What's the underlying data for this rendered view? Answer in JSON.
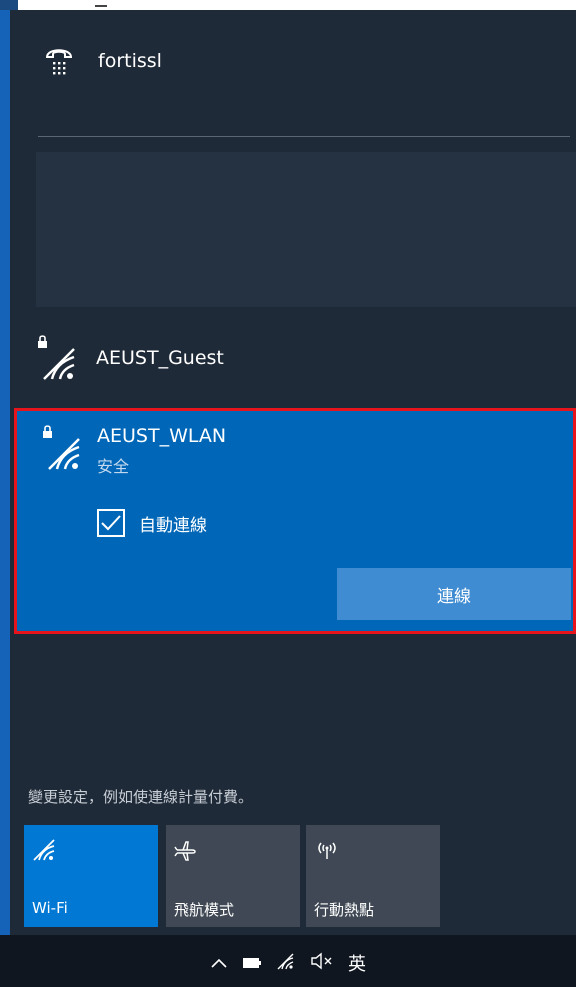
{
  "vpn": {
    "label": "fortissl",
    "icon": "vpn-dialup-icon"
  },
  "networks": [
    {
      "name": "AEUST_Guest",
      "icon": "wifi-secured-icon"
    },
    {
      "name": "AEUST_WLAN",
      "status": "安全",
      "icon": "wifi-secured-icon",
      "auto_connect_label": "自動連線",
      "auto_connect_checked": true,
      "connect_label": "連線"
    }
  ],
  "settings_link": "變更設定，例如使連線計量付費。",
  "quick_actions": [
    {
      "label": "Wi-Fi",
      "icon": "wifi-icon",
      "active": true
    },
    {
      "label": "飛航模式",
      "icon": "airplane-icon",
      "active": false
    },
    {
      "label": "行動熱點",
      "icon": "hotspot-icon",
      "active": false
    }
  ],
  "taskbar": {
    "icons": [
      "chevron-up-icon",
      "battery-icon",
      "wifi-icon",
      "volume-mute-icon"
    ],
    "language": "英"
  },
  "colors": {
    "accent": "#0078d4",
    "selected_bg": "#0067b8",
    "flyout_bg": "#1f2a38",
    "highlight_border": "#e8141b"
  }
}
